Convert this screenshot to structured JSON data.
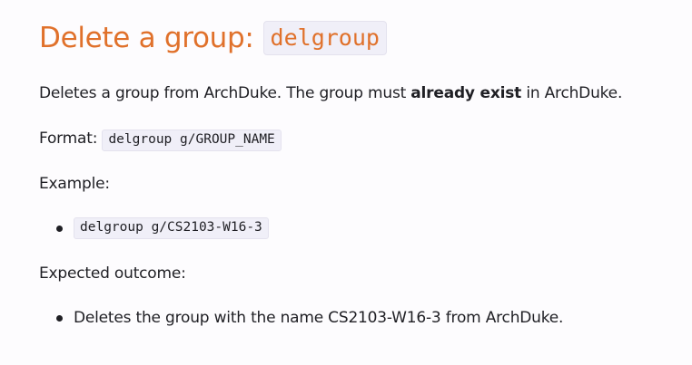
{
  "heading": {
    "text": "Delete a group:",
    "command": "delgroup"
  },
  "description": {
    "before": "Deletes a group from ArchDuke. The group must ",
    "bold": "already exist",
    "after": " in ArchDuke."
  },
  "format": {
    "label": "Format:",
    "code": "delgroup g/GROUP_NAME"
  },
  "example": {
    "label": "Example:",
    "items": [
      "delgroup g/CS2103-W16-3"
    ]
  },
  "outcome": {
    "label": "Expected outcome:",
    "items": [
      "Deletes the group with the name CS2103-W16-3 from ArchDuke."
    ]
  },
  "colors": {
    "heading": "#e0712b",
    "code_background": "#f0eff8",
    "text": "#1f1f24",
    "background": "#fdfcfe"
  }
}
